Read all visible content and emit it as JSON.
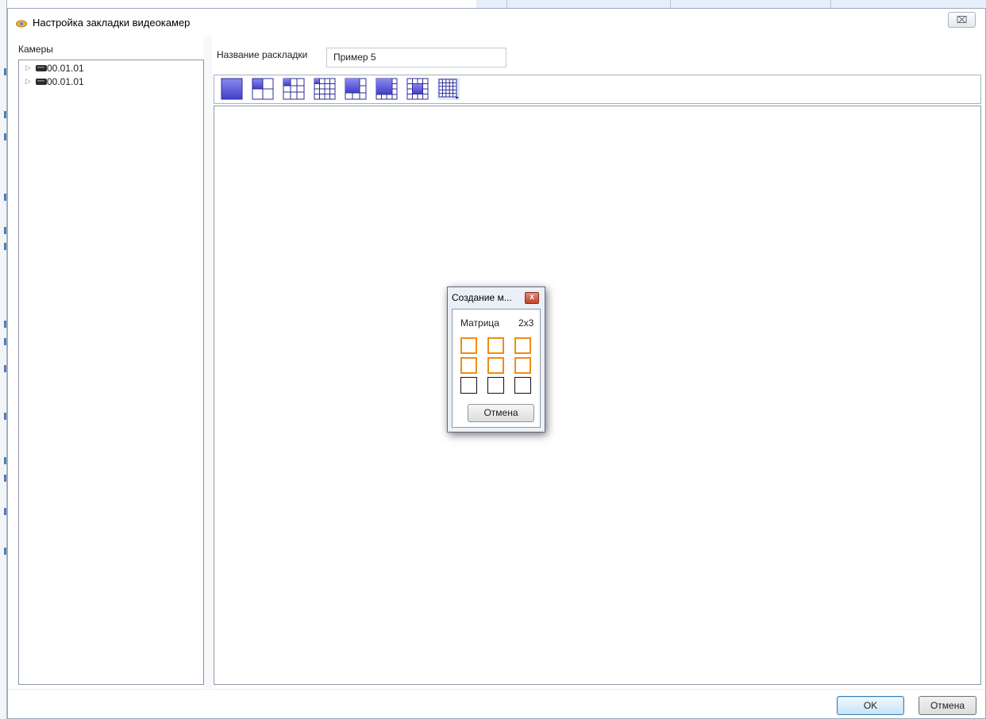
{
  "window": {
    "title": "Настройка закладки видеокамер",
    "close_glyph": "⌧"
  },
  "cameras": {
    "label": "Камеры",
    "items": [
      {
        "label": "00.01.01",
        "icon": "camera-icon"
      },
      {
        "label": "00.01.01",
        "icon": "camera-icon"
      }
    ]
  },
  "layout_name": {
    "label": "Название раскладки",
    "value": "Пример 5"
  },
  "toolbar": {
    "buttons": [
      {
        "name": "layout-1x1"
      },
      {
        "name": "layout-2x2"
      },
      {
        "name": "layout-3x3"
      },
      {
        "name": "layout-4x4"
      },
      {
        "name": "layout-1plus5"
      },
      {
        "name": "layout-1plus7"
      },
      {
        "name": "layout-1plus12"
      },
      {
        "name": "layout-custom-matrix"
      }
    ]
  },
  "popup": {
    "title": "Создание м...",
    "close_glyph": "x",
    "matrix_label": "Матрица",
    "matrix_size": "2x3",
    "rows": 3,
    "cols": 3,
    "selected_rows": 2,
    "selected_cols": 3,
    "cancel_label": "Отмена"
  },
  "footer": {
    "ok_label": "OK",
    "cancel_label": "Отмена"
  },
  "colors": {
    "accent": "#5b5bd6",
    "selection": "#f28c13"
  }
}
